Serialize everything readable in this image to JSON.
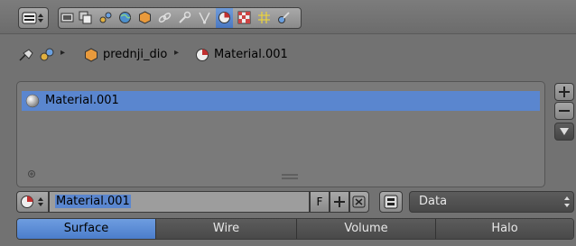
{
  "header": {
    "editor_type_icon": "properties-editor-icon",
    "context_tabs": [
      {
        "icon": "render-icon"
      },
      {
        "icon": "render-layers-icon"
      },
      {
        "icon": "scene-icon"
      },
      {
        "icon": "world-icon"
      },
      {
        "icon": "object-icon"
      },
      {
        "icon": "constraints-icon"
      },
      {
        "icon": "modifiers-icon"
      },
      {
        "icon": "mesh-data-icon"
      },
      {
        "icon": "material-icon",
        "active": true
      },
      {
        "icon": "texture-icon"
      },
      {
        "icon": "particles-icon"
      },
      {
        "icon": "physics-icon"
      }
    ]
  },
  "breadcrumb": {
    "object_name": "prednji_dio",
    "material_name": "Material.001"
  },
  "material_slots": {
    "items": [
      {
        "label": "Material.001",
        "selected": true
      }
    ]
  },
  "datablock": {
    "name": "Material.001",
    "fake_user_label": "F",
    "link_label": "Data"
  },
  "tabs": [
    {
      "label": "Surface",
      "active": true
    },
    {
      "label": "Wire"
    },
    {
      "label": "Volume"
    },
    {
      "label": "Halo"
    }
  ],
  "colors": {
    "accent": "#5a86cf",
    "panel_bg": "#727272",
    "text_field": "#9a9a9a"
  }
}
